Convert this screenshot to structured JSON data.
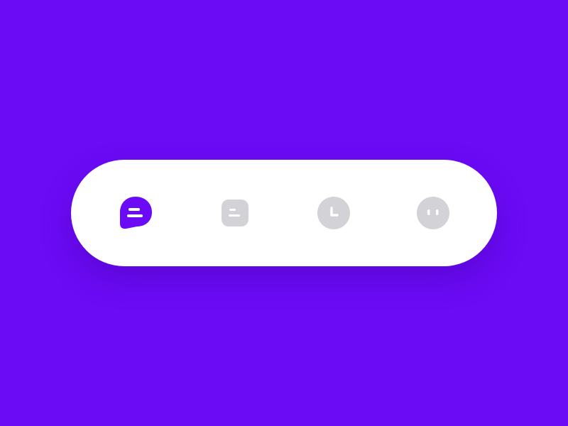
{
  "colors": {
    "background": "#6B0AF5",
    "bar": "#FFFFFF",
    "active": "#6B0AF5",
    "inactive": "#D2D2D7",
    "glyph": "#FFFFFF"
  },
  "tab_bar": {
    "active_index": 0,
    "tabs": [
      {
        "icon": "chat-bubble-icon",
        "active": true
      },
      {
        "icon": "document-icon",
        "active": false
      },
      {
        "icon": "clock-icon",
        "active": false
      },
      {
        "icon": "face-icon",
        "active": false
      }
    ]
  }
}
